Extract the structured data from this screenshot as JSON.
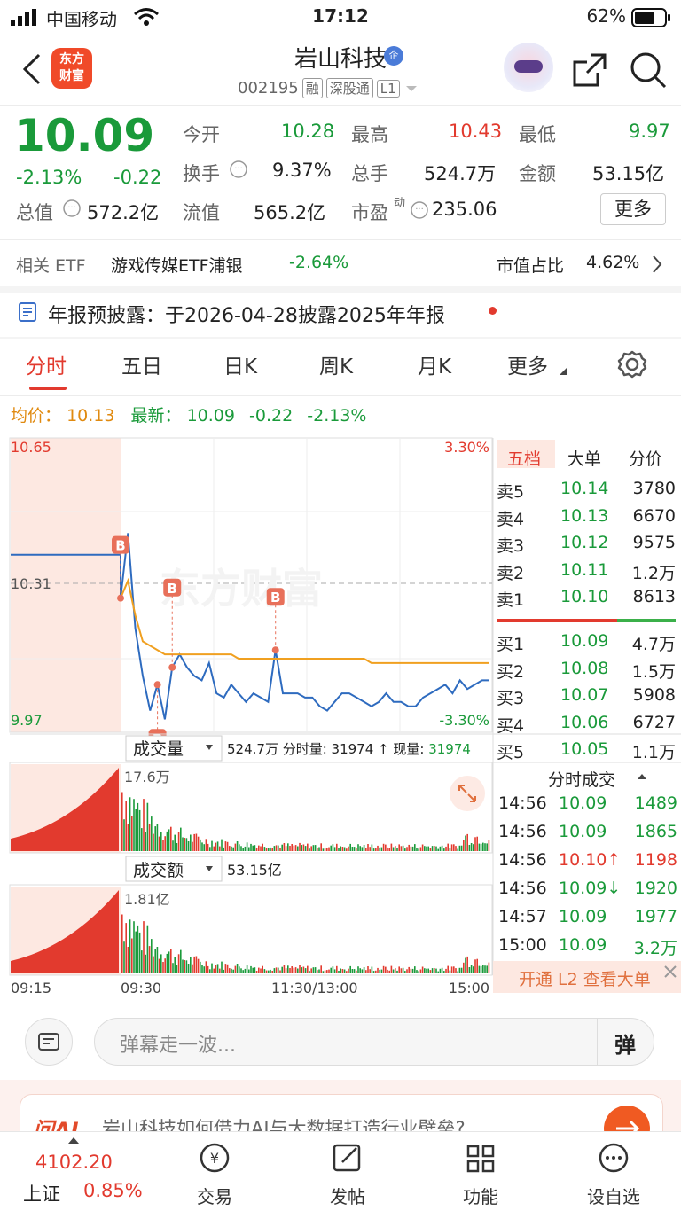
{
  "status": {
    "carrier": "中国移动",
    "time": "17:12",
    "battery": "62%"
  },
  "header": {
    "logo_line1": "东方",
    "logo_line2": "财富",
    "name": "岩山科技",
    "qi_badge": "企",
    "code": "002195",
    "tag_rong": "融",
    "tag_sgt": "深股通",
    "tag_l1": "L1"
  },
  "quote": {
    "price": "10.09",
    "pct": "-2.13%",
    "chg": "-0.22",
    "open_label": "今开",
    "open": "10.28",
    "high_label": "最高",
    "high": "10.43",
    "low_label": "最低",
    "low": "9.97",
    "turnover_label": "换手",
    "turnover": "9.37%",
    "vol_label": "总手",
    "vol": "524.7万",
    "amount_label": "金额",
    "amount": "53.15亿",
    "mcap_label": "总值",
    "mcap": "572.2亿",
    "float_label": "流值",
    "float": "565.2亿",
    "pe_label": "市盈",
    "pe_sup": "动",
    "pe": "235.06",
    "more": "更多"
  },
  "etf": {
    "label": "相关 ETF",
    "name": "游戏传媒ETF浦银",
    "pct": "-2.64%",
    "share_label": "市值占比",
    "share": "4.62%"
  },
  "notice": {
    "text": "年报预披露：于2026-04-28披露2025年年报"
  },
  "tabs": [
    "分时",
    "五日",
    "日K",
    "周K",
    "月K",
    "更多"
  ],
  "avgline": {
    "avg_label": "均价：",
    "avg": "10.13",
    "last_label": "最新：",
    "last": "10.09",
    "chg": "-0.22",
    "pct": "-2.13%"
  },
  "chart_labels": {
    "top_price": "10.65",
    "top_pct": "3.30%",
    "mid_price": "10.31",
    "low_price": "9.97",
    "low_pct": "-3.30%",
    "vol_title": "成交量",
    "vol_info": "524.7万 分时量: 31974 ↑ 现量: 31974",
    "vol_info_a": "524.7万 分时量: 31974 ↑ 现量: ",
    "vol_info_b": "31974",
    "vol_max": "17.6万",
    "amt_title": "成交额",
    "amt_info": "53.15亿",
    "amt_max": "1.81亿",
    "t0": "09:15",
    "t1": "09:30",
    "t2": "11:30/13:00",
    "t3": "15:00",
    "marker": "B"
  },
  "orderbook": {
    "tabs": [
      "五档",
      "大单",
      "分价"
    ],
    "sells": [
      [
        "卖5",
        "10.14",
        "3780"
      ],
      [
        "卖4",
        "10.13",
        "6670"
      ],
      [
        "卖3",
        "10.12",
        "9575"
      ],
      [
        "卖2",
        "10.11",
        "1.2万"
      ],
      [
        "卖1",
        "10.10",
        "8613"
      ]
    ],
    "buys": [
      [
        "买1",
        "10.09",
        "4.7万"
      ],
      [
        "买2",
        "10.08",
        "1.5万"
      ],
      [
        "买3",
        "10.07",
        "5908"
      ],
      [
        "买4",
        "10.06",
        "6727"
      ],
      [
        "买5",
        "10.05",
        "1.1万"
      ]
    ],
    "ticks_title": "分时成交",
    "ticks": [
      [
        "14:56",
        "10.09",
        "1489",
        "green"
      ],
      [
        "14:56",
        "10.09",
        "1865",
        "green"
      ],
      [
        "14:56",
        "10.10↑",
        "1198",
        "red"
      ],
      [
        "14:56",
        "10.09↓",
        "1920",
        "green"
      ],
      [
        "14:57",
        "10.09",
        "1977",
        "green"
      ],
      [
        "15:00",
        "10.09",
        "3.2万",
        "green"
      ]
    ],
    "l2": "开通 L2 查看大单"
  },
  "danmu": {
    "placeholder": "弹幕走一波...",
    "btn": "弹"
  },
  "ai": {
    "logo": "问AI",
    "text": "岩山科技如何借力AI与大数据打造行业壁垒?"
  },
  "tabbar": {
    "index_value": "4102.20",
    "index_name": "上证",
    "index_pct": "0.85%",
    "trade": "交易",
    "post": "发帖",
    "func": "功能",
    "watch": "设自选"
  },
  "colors": {
    "up": "#e23a2e",
    "down": "#1a9a3a",
    "price_line": "#2e6bbf",
    "avg_line": "#f0a020",
    "accent": "#e23a2e"
  },
  "chart_data": {
    "type": "line",
    "ylim": [
      9.97,
      10.65
    ],
    "prev_close": 10.31,
    "series": [
      {
        "name": "",
        "values": [
          10.38,
          10.38,
          10.38,
          10.38,
          10.38,
          10.38,
          10.38,
          10.38,
          10.38,
          10.38,
          10.28,
          10.43,
          10.21,
          10.1,
          10.02,
          10.08,
          10.0,
          10.12,
          10.15,
          10.12,
          10.1,
          10.09,
          10.13,
          10.06,
          10.05,
          10.08,
          10.06,
          10.04,
          10.06,
          10.05,
          10.04,
          10.16,
          10.06,
          10.06,
          10.06,
          10.05,
          10.05,
          10.03,
          10.02,
          10.04,
          10.06,
          10.06,
          10.05,
          10.04,
          10.03,
          10.04,
          10.06,
          10.04,
          10.04,
          10.03,
          10.03,
          10.05,
          10.06,
          10.07,
          10.08,
          10.06,
          10.09,
          10.07,
          10.08,
          10.09,
          10.09
        ]
      },
      {
        "name": "",
        "values": [
          null,
          null,
          null,
          null,
          null,
          null,
          null,
          null,
          null,
          null,
          10.28,
          10.32,
          10.24,
          10.18,
          10.17,
          10.16,
          10.15,
          10.15,
          10.15,
          10.15,
          10.15,
          10.15,
          10.15,
          10.15,
          10.15,
          10.15,
          10.14,
          10.14,
          10.14,
          10.14,
          10.14,
          10.14,
          10.14,
          10.14,
          10.14,
          10.14,
          10.14,
          10.14,
          10.14,
          10.14,
          10.14,
          10.14,
          10.14,
          10.14,
          10.13,
          10.13,
          10.13,
          10.13,
          10.13,
          10.13,
          10.13,
          10.13,
          10.13,
          10.13,
          10.13,
          10.13,
          10.13,
          10.13,
          10.13,
          10.13,
          10.13
        ]
      }
    ],
    "buy_markers": [
      {
        "index": 10
      },
      {
        "index": 15
      },
      {
        "index": 17
      },
      {
        "index": 31
      }
    ]
  }
}
